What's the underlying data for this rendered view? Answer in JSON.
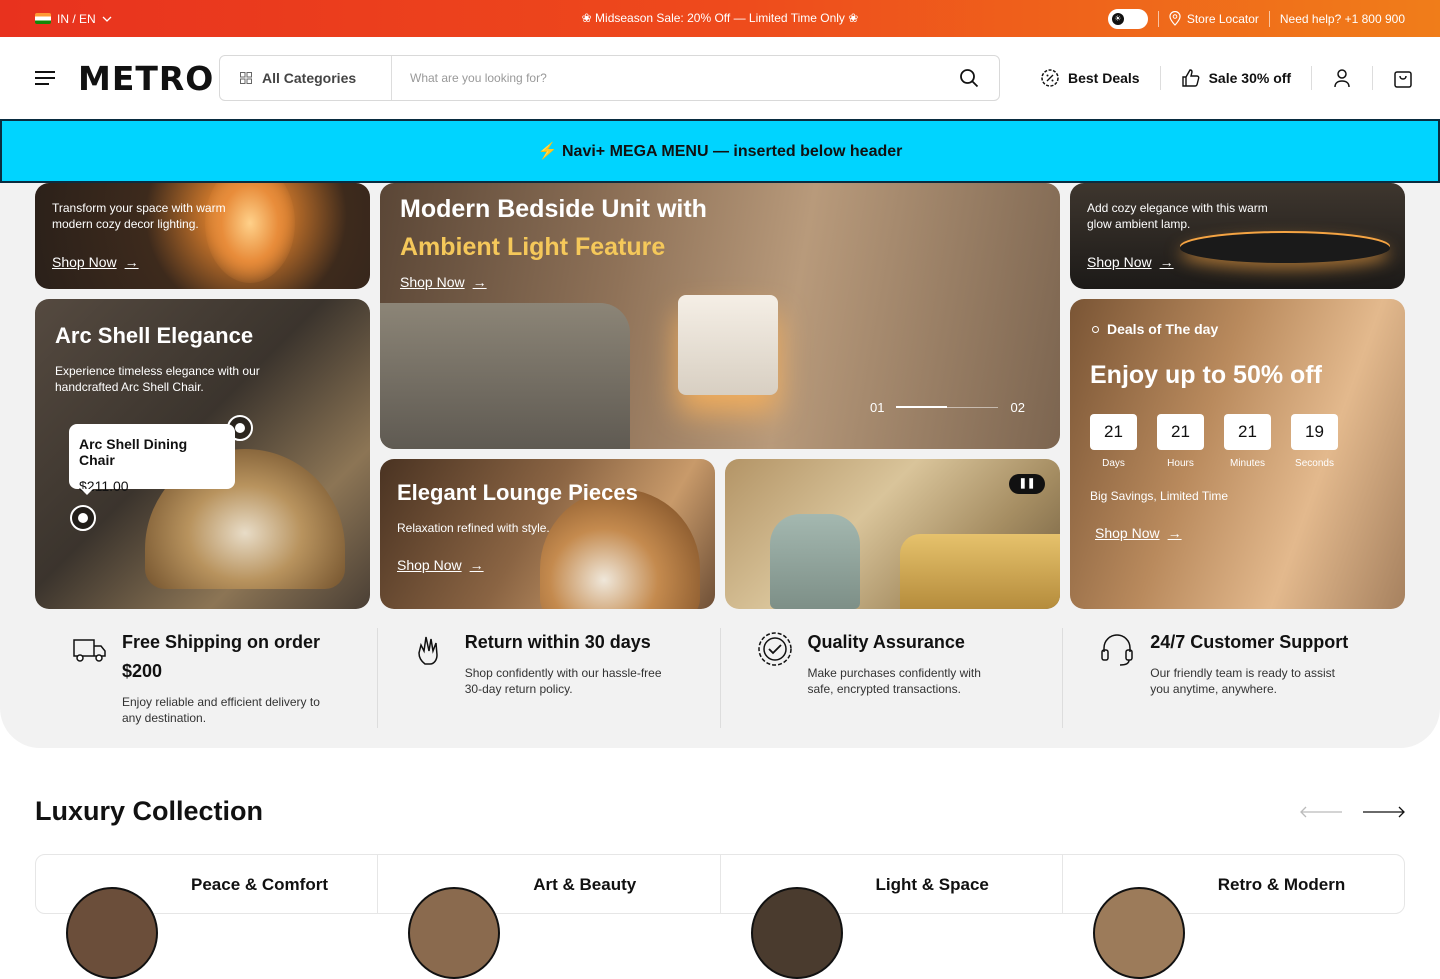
{
  "topbar": {
    "locale": "IN / EN",
    "promo": "❀ Midseason Sale: 20% Off — Limited Time Only ❀",
    "store_locator": "Store Locator",
    "help": "Need help? +1 800 900"
  },
  "header": {
    "logo": "METRO",
    "category": "All Categories",
    "search_placeholder": "What are you looking for?",
    "best_deals": "Best Deals",
    "sale": "Sale 30% off"
  },
  "mega_banner": "⚡ Navi+ MEGA MENU — inserted below header",
  "hero": {
    "card1": {
      "desc": "Transform your space with warm modern cozy decor lighting.",
      "cta": "Shop Now"
    },
    "card2": {
      "title_line1": "Modern Bedside Unit with",
      "title_line2": "Ambient Light Feature",
      "cta": "Shop Now",
      "page_current": "01",
      "page_total": "02",
      "progress": 0.5
    },
    "card3": {
      "desc": "Add cozy elegance with this warm glow ambient lamp.",
      "cta": "Shop Now"
    },
    "card4": {
      "title": "Arc Shell Elegance",
      "desc": "Experience timeless elegance with our handcrafted Arc Shell Chair.",
      "tooltip_name": "Arc Shell Dining Chair",
      "tooltip_price": "$211.00"
    },
    "card5": {
      "eyebrow": "Deals of The day",
      "title": "Enjoy up to 50% off",
      "countdown": [
        {
          "value": "21",
          "label": "Days"
        },
        {
          "value": "21",
          "label": "Hours"
        },
        {
          "value": "21",
          "label": "Minutes"
        },
        {
          "value": "19",
          "label": "Seconds"
        }
      ],
      "subtitle": "Big Savings, Limited Time",
      "cta": "Shop Now"
    },
    "card6": {
      "title": "Elegant Lounge Pieces",
      "desc": "Relaxation refined with style.",
      "cta": "Shop Now"
    }
  },
  "features": [
    {
      "title": "Free Shipping on order $200",
      "desc": "Enjoy reliable and efficient delivery to any destination."
    },
    {
      "title": "Return within 30 days",
      "desc": "Shop confidently with our hassle-free 30-day return policy."
    },
    {
      "title": "Quality Assurance",
      "desc": "Make purchases confidently with safe, encrypted transactions."
    },
    {
      "title": "24/7 Customer Support",
      "desc": "Our friendly team is ready to assist you anytime, anywhere."
    }
  ],
  "luxury": {
    "title": "Luxury Collection",
    "items": [
      "Peace & Comfort",
      "Art & Beauty",
      "Light & Space",
      "Retro & Modern"
    ]
  },
  "colors": {
    "topbar_start": "#e8321e",
    "topbar_end": "#f07d1a",
    "mega": "#00d4ff",
    "accent_gold": "#f5c85a"
  }
}
